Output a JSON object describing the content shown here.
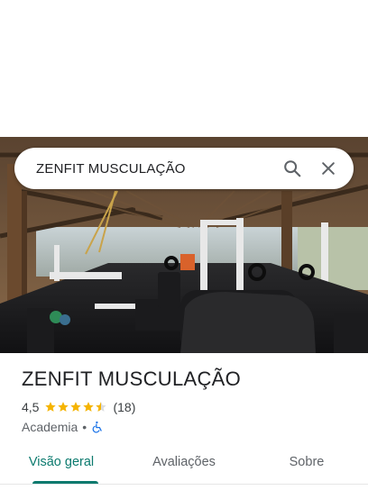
{
  "search": {
    "query": "ZENFIT MUSCULAÇÃO",
    "search_icon": "search-icon",
    "close_icon": "close-icon"
  },
  "place": {
    "name": "ZENFIT MUSCULAÇÃO",
    "rating": "4,5",
    "rating_value": 4.5,
    "star_color": "#f5b400",
    "review_count": "(18)",
    "category": "Academia",
    "separator": "•",
    "accessibility_icon": "wheelchair-icon",
    "accessibility_color": "#1a73e8"
  },
  "tabs": [
    {
      "label": "Visão geral",
      "active": true
    },
    {
      "label": "Avaliações",
      "active": false
    },
    {
      "label": "Sobre",
      "active": false
    }
  ],
  "accent_color": "#0b7a6e"
}
